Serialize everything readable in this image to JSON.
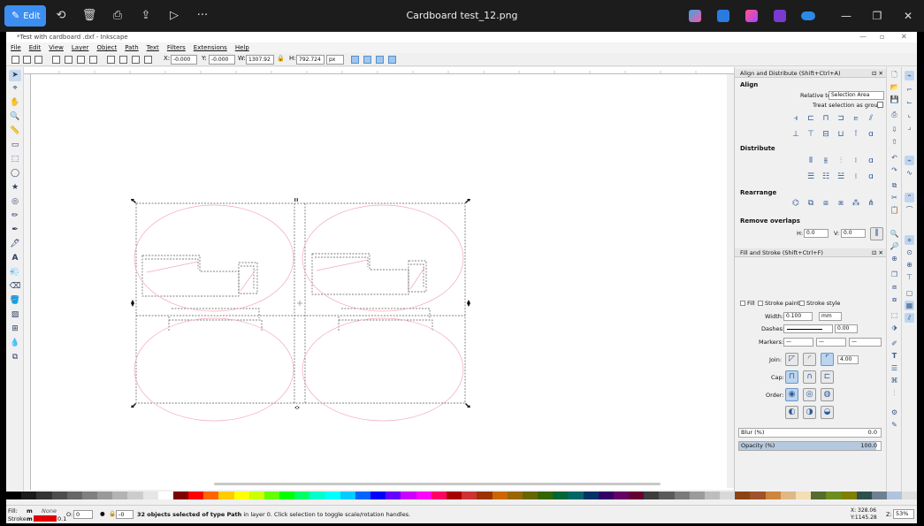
{
  "viewer": {
    "edit_label": "Edit",
    "title": "Cardboard test_12.png",
    "more": "···",
    "win_min": "—",
    "win_max": "❐",
    "win_close": "✕"
  },
  "inkscape": {
    "window_title": "*Test with cardboard .dxf - Inkscape",
    "menu": [
      "File",
      "Edit",
      "View",
      "Layer",
      "Object",
      "Path",
      "Text",
      "Filters",
      "Extensions",
      "Help"
    ],
    "toolbar": {
      "x_label": "X:",
      "x_value": "-0.000",
      "y_label": "Y:",
      "y_value": "-0.000",
      "w_label": "W:",
      "w_value": "1307.92",
      "h_label": "H:",
      "h_value": "792.724",
      "unit": "px"
    },
    "align": {
      "header": "Align and Distribute (Shift+Ctrl+A)",
      "align_title": "Align",
      "relative_label": "Relative to:",
      "relative_value": "Selection Area",
      "treat_group": "Treat selection as group:",
      "distribute_title": "Distribute",
      "rearrange_title": "Rearrange",
      "overlaps_title": "Remove overlaps",
      "h_label": "H:",
      "h_value": "0.0",
      "v_label": "V:",
      "v_value": "0.0"
    },
    "fill_stroke": {
      "header": "Fill and Stroke (Shift+Ctrl+F)",
      "tab_fill": "Fill",
      "tab_stroke_paint": "Stroke paint",
      "tab_stroke_style": "Stroke style",
      "width_label": "Width:",
      "width_value": "0.100",
      "width_unit": "mm",
      "dashes_label": "Dashes:",
      "dashes_value": "0.00",
      "markers_label": "Markers:",
      "join_label": "Join:",
      "join_value": "4.00",
      "cap_label": "Cap:",
      "order_label": "Order:",
      "blur_label": "Blur (%)",
      "blur_value": "0.0",
      "opacity_label": "Opacity (%)",
      "opacity_value": "100.0"
    },
    "status": {
      "fill_label": "Fill:",
      "fill_value": "m",
      "fill_none": "None",
      "stroke_label": "Stroke:",
      "stroke_value": "m",
      "stroke_width": "0.1",
      "opacity_label": "O:",
      "opacity_value": "0",
      "layer_value": "-0",
      "message_bold": "32 objects selected of type Path",
      "message_rest": " in layer 0. Click selection to toggle scale/rotation handles.",
      "x_coord": "X: 328.06",
      "y_coord": "Y:1145.28",
      "zoom_label": "Z:",
      "zoom_value": "53%"
    }
  },
  "colors": {
    "accent": "#3c8ff0",
    "viewer_bg": "#1c1c1c",
    "cut_line": "#f2a8b8",
    "palette": [
      "#000000",
      "#1a1a1a",
      "#333333",
      "#4d4d4d",
      "#666666",
      "#808080",
      "#999999",
      "#b3b3b3",
      "#cccccc",
      "#e6e6e6",
      "#ffffff",
      "#800000",
      "#ff0000",
      "#ff6600",
      "#ffcc00",
      "#ffff00",
      "#ccff00",
      "#66ff00",
      "#00ff00",
      "#00ff66",
      "#00ffcc",
      "#00ffff",
      "#00ccff",
      "#0066ff",
      "#0000ff",
      "#6600ff",
      "#cc00ff",
      "#ff00ff",
      "#ff0066",
      "#aa0000",
      "#cc3333",
      "#993300",
      "#cc6600",
      "#996600",
      "#666600",
      "#336600",
      "#006633",
      "#006666",
      "#003366",
      "#330066",
      "#660066",
      "#660033",
      "#3d3d3d",
      "#5a5a5a",
      "#7a7a7a",
      "#9b9b9b",
      "#bdbdbd",
      "#d8d8d8",
      "#8b4513",
      "#a0522d",
      "#cd853f",
      "#deb887",
      "#f5deb3",
      "#556b2f",
      "#6b8e23",
      "#808000",
      "#2f4f4f",
      "#708090",
      "#b0c4de",
      "#e0e0e0"
    ]
  }
}
